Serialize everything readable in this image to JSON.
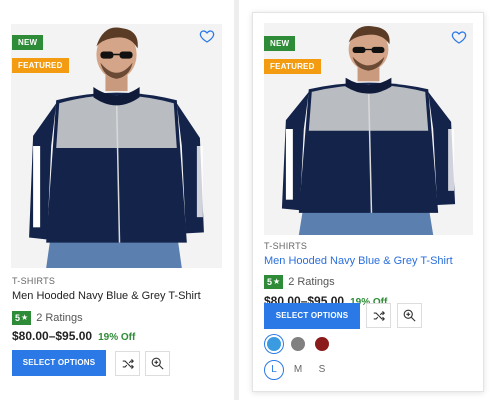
{
  "colors": {
    "accent": "#2b79e6",
    "badge_new": "#2e8b37",
    "badge_featured": "#f39c12",
    "rating": "#2e8b37"
  },
  "cards": [
    {
      "badges": {
        "new": "NEW",
        "featured": "FEATURED"
      },
      "category": "T-SHIRTS",
      "title": "Men Hooded Navy Blue & Grey T-Shirt",
      "rating": {
        "value": "5",
        "star": "★",
        "count_text": "2 Ratings"
      },
      "price": "$80.00–$95.00",
      "discount": "19% Off",
      "button": "SELECT OPTIONS"
    },
    {
      "badges": {
        "new": "NEW",
        "featured": "FEATURED"
      },
      "category": "T-SHIRTS",
      "title": "Men Hooded Navy Blue & Grey T-Shirt",
      "rating": {
        "value": "5",
        "star": "★",
        "count_text": "2 Ratings"
      },
      "price": "$80.00–$95.00",
      "discount": "19% Off",
      "button": "SELECT OPTIONS",
      "swatches": [
        "#3a9be0",
        "#808080",
        "#8b1a1a"
      ],
      "selected_swatch": 0,
      "sizes": [
        "L",
        "M",
        "S"
      ],
      "selected_size": "L"
    }
  ]
}
